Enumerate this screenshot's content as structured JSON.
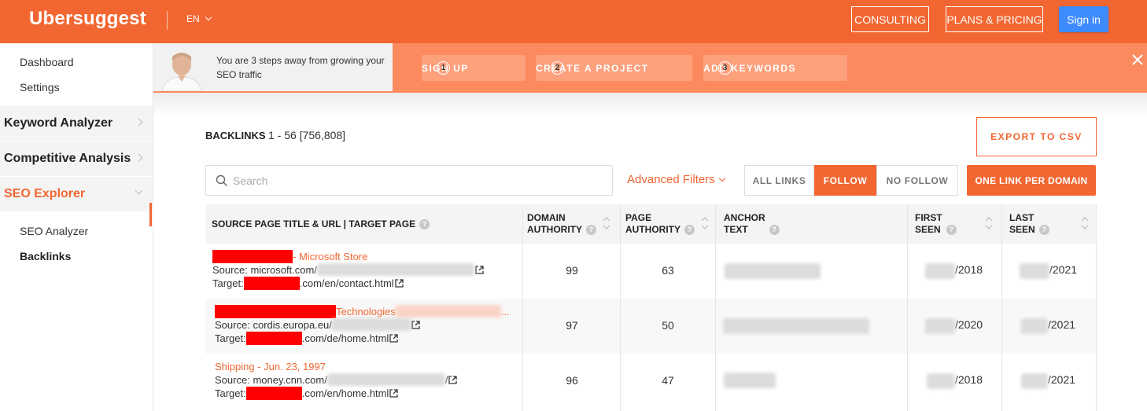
{
  "header": {
    "logo": "Ubersuggest",
    "lang": "EN",
    "consulting": "CONSULTING",
    "plans": "PLANS & PRICING",
    "signin": "Sign in"
  },
  "sidebar": {
    "dashboard": "Dashboard",
    "settings": "Settings",
    "keyword_analyzer": "Keyword Analyzer",
    "competitive_analysis": "Competitive Analysis",
    "seo_explorer": "SEO Explorer",
    "seo_analyzer": "SEO Analyzer",
    "backlinks": "Backlinks"
  },
  "banner": {
    "text": "You are 3 steps away from growing your SEO traffic",
    "steps": [
      {
        "num": "1",
        "label": "SIGN UP"
      },
      {
        "num": "2",
        "label": "CREATE A PROJECT"
      },
      {
        "num": "3",
        "label": "ADD KEYWORDS"
      }
    ]
  },
  "backlinks": {
    "title": "BACKLINKS",
    "count": "1 - 56 [756,808]",
    "export": "EXPORT TO CSV",
    "search_placeholder": "Search",
    "advanced_filters": "Advanced Filters",
    "filters": [
      "ALL LINKS",
      "FOLLOW",
      "NO FOLLOW"
    ],
    "active_filter": "FOLLOW",
    "one_link": "ONE LINK PER DOMAIN"
  },
  "table": {
    "columns": {
      "source": "SOURCE PAGE TITLE & URL | TARGET PAGE",
      "da1": "DOMAIN",
      "da2": "AUTHORITY",
      "pa1": "PAGE",
      "pa2": "AUTHORITY",
      "at1": "ANCHOR",
      "at2": "TEXT",
      "fs1": "FIRST",
      "fs2": "SEEN",
      "ls1": "LAST",
      "ls2": "SEEN"
    },
    "rows": [
      {
        "title": "- Microsoft Store",
        "source_label": "Source:",
        "source": "microsoft.com/",
        "target_label": "Target:",
        "target": ".com/en/contact.html",
        "domain_authority": "99",
        "page_authority": "63",
        "first_seen": "/2018",
        "last_seen": "/2021"
      },
      {
        "title": "Technologies",
        "title_suffix": "...",
        "source_label": "Source:",
        "source": "cordis.europa.eu/",
        "target_label": "Target:",
        "target": ".com/de/home.html",
        "domain_authority": "97",
        "page_authority": "50",
        "first_seen": "/2020",
        "last_seen": "/2021"
      },
      {
        "title": "Shipping - Jun. 23, 1997",
        "source_label": "Source:",
        "source": "money.cnn.com/",
        "source_suffix": "/",
        "target_label": "Target:",
        "target": ".com/en/home.html",
        "domain_authority": "96",
        "page_authority": "47",
        "first_seen": "/2018",
        "last_seen": "/2021"
      }
    ]
  },
  "colors": {
    "brand": "#f26631",
    "banner": "#fc8a5f",
    "signin": "#3d8bfd"
  }
}
